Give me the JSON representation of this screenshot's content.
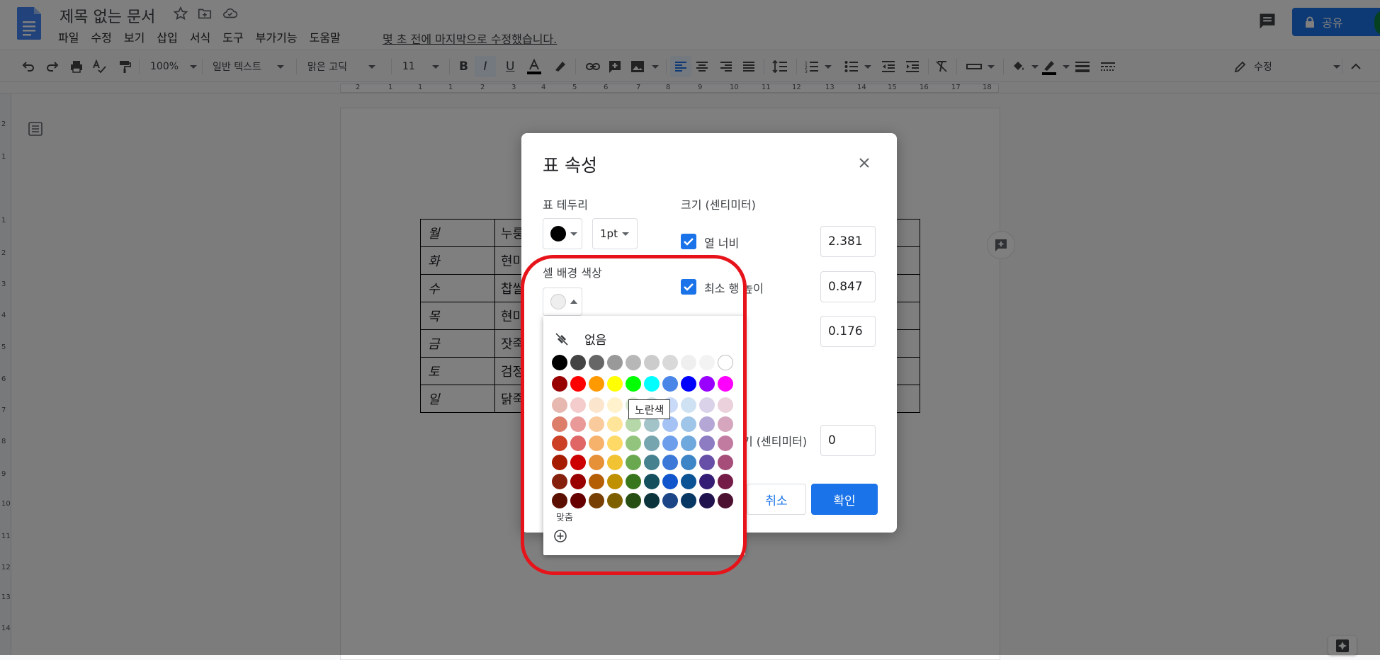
{
  "header": {
    "doc_title": "제목 없는 문서",
    "menu": [
      "파일",
      "수정",
      "보기",
      "삽입",
      "서식",
      "도구",
      "부가기능",
      "도움말"
    ],
    "last_edit": "몇 초 전에 마지막으로 수정했습니다.",
    "share_label": "공유"
  },
  "toolbar": {
    "zoom": "100%",
    "style": "일반 텍스트",
    "font": "맑은 고딕",
    "font_size": "11",
    "mode": "수정"
  },
  "ruler": {
    "top_numbers": [
      "2",
      "1",
      "1",
      "1",
      "2",
      "3",
      "4",
      "5",
      "6",
      "7",
      "8",
      "9",
      "10",
      "11",
      "12",
      "13",
      "14",
      "15",
      "16",
      "17",
      "18"
    ],
    "left_numbers": [
      "2",
      "1",
      "1",
      "2",
      "3",
      "4",
      "5",
      "6",
      "7",
      "8",
      "9",
      "10",
      "11",
      "12",
      "13",
      "14"
    ]
  },
  "doc_table": {
    "rows": [
      {
        "day": "월",
        "food": "누룽"
      },
      {
        "day": "화",
        "food": "현미"
      },
      {
        "day": "수",
        "food": "찹쌀"
      },
      {
        "day": "목",
        "food": "현미"
      },
      {
        "day": "금",
        "food": "잣죽"
      },
      {
        "day": "토",
        "food": "검정"
      },
      {
        "day": "일",
        "food": "닭죽"
      }
    ]
  },
  "dialog": {
    "title": "표 속성",
    "border_label": "표 테두리",
    "border_width": "1pt",
    "bg_color_label": "셀 배경 색상",
    "size_label": "크기 (센티미터)",
    "col_width_label": "열 너비",
    "col_width_value": "2.381",
    "min_row_height_label": "최소 행 높이",
    "min_row_height_value": "0.847",
    "padding_value": "0.176",
    "partial_label": "기 (센티미터)",
    "partial_value": "0",
    "cancel_label": "취소",
    "ok_label": "확인"
  },
  "palette": {
    "none_label": "없음",
    "custom_label": "맞춤",
    "tooltip": "노란색",
    "rows": [
      [
        "#000000",
        "#434343",
        "#666666",
        "#999999",
        "#b7b7b7",
        "#cccccc",
        "#d9d9d9",
        "#efefef",
        "#f3f3f3",
        "#ffffff"
      ],
      [
        "#980000",
        "#ff0000",
        "#ff9900",
        "#ffff00",
        "#00ff00",
        "#00ffff",
        "#4a86e8",
        "#0000ff",
        "#9900ff",
        "#ff00ff"
      ],
      [
        "#e6b8af",
        "#f4cccc",
        "#fce5cd",
        "#fff2cc",
        "#d9ead3",
        "#d0e0e3",
        "#c9daf8",
        "#cfe2f3",
        "#d9d2e9",
        "#ead1dc"
      ],
      [
        "#dd7e6b",
        "#ea9999",
        "#f9cb9c",
        "#ffe599",
        "#b6d7a8",
        "#a2c4c9",
        "#a4c2f4",
        "#9fc5e8",
        "#b4a7d6",
        "#d5a6bd"
      ],
      [
        "#cc4125",
        "#e06666",
        "#f6b26b",
        "#ffd966",
        "#93c47d",
        "#76a5af",
        "#6d9eeb",
        "#6fa8dc",
        "#8e7cc3",
        "#c27ba0"
      ],
      [
        "#a61c00",
        "#cc0000",
        "#e69138",
        "#f1c232",
        "#6aa84f",
        "#45818e",
        "#3c78d8",
        "#3d85c6",
        "#674ea7",
        "#a64d79"
      ],
      [
        "#85200c",
        "#990000",
        "#b45f06",
        "#bf9000",
        "#38761d",
        "#134f5c",
        "#1155cc",
        "#0b5394",
        "#351c75",
        "#741b47"
      ],
      [
        "#5b0f00",
        "#660000",
        "#783f04",
        "#7f6000",
        "#274e13",
        "#0c343d",
        "#1c4587",
        "#073763",
        "#20124d",
        "#4c1130"
      ]
    ]
  },
  "colors": {
    "accent": "#1a73e8",
    "highlight": "#e6141a"
  }
}
